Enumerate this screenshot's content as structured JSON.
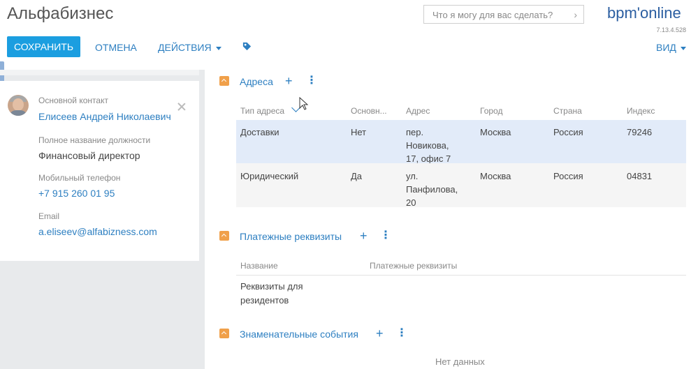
{
  "header": {
    "title": "Альфабизнес",
    "search_placeholder": "Что я могу для вас сделать?",
    "logo": "bpm'online",
    "version": "7.13.4.528"
  },
  "toolbar": {
    "save": "СОХРАНИТЬ",
    "cancel": "ОТМЕНА",
    "actions": "ДЕЙСТВИЯ",
    "view": "ВИД"
  },
  "profile": {
    "contact_label": "Основной контакт",
    "contact_name": "Елисеев Андрей Николаевич",
    "position_label": "Полное название должности",
    "position_value": "Финансовый директор",
    "mobile_label": "Мобильный телефон",
    "mobile_value": "+7 915 260 01 95",
    "email_label": "Email",
    "email_value": "a.eliseev@alfabizness.com"
  },
  "addresses": {
    "title": "Адреса",
    "columns": [
      "Тип адреса",
      "Основн...",
      "Адрес",
      "Город",
      "Страна",
      "Индекс"
    ],
    "rows": [
      {
        "type": "Доставки",
        "primary": "Нет",
        "address": "пер. Новикова, 17, офис 7",
        "city": "Москва",
        "country": "Россия",
        "index": "79246"
      },
      {
        "type": "Юридический",
        "primary": "Да",
        "address": "ул. Панфилова, 20",
        "city": "Москва",
        "country": "Россия",
        "index": "04831"
      }
    ]
  },
  "payment": {
    "title": "Платежные реквизиты",
    "columns": [
      "Название",
      "Платежные реквизиты"
    ],
    "rows": [
      {
        "name": "Реквизиты для резидентов",
        "details": ""
      }
    ]
  },
  "events": {
    "title": "Знаменательные события",
    "empty": "Нет данных"
  },
  "colors": {
    "accent": "#1b9ee0",
    "link": "#2d7fc1",
    "collapse": "#f0a04a",
    "selected_row": "#e2ebf9"
  }
}
